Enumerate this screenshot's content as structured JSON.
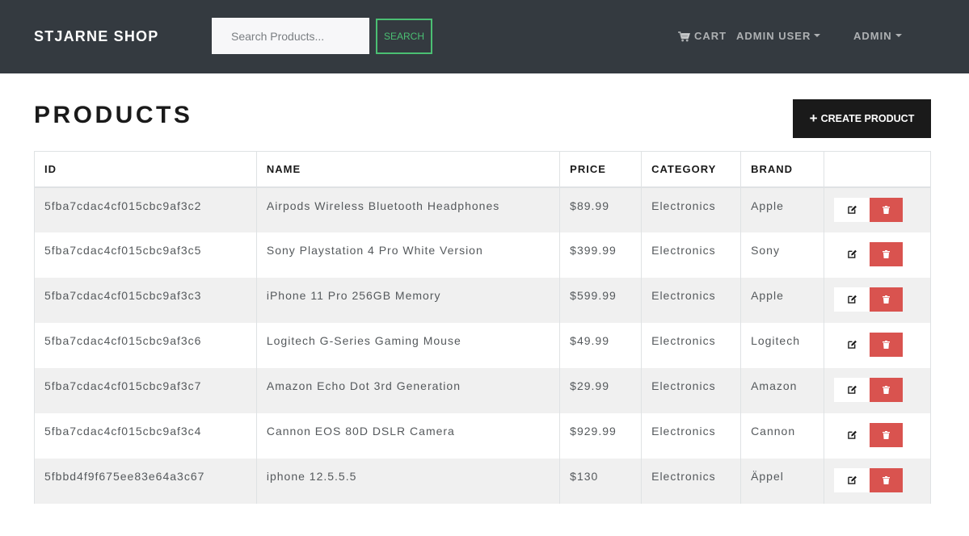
{
  "navbar": {
    "brand": "STJARNE SHOP",
    "search_placeholder": "Search Products...",
    "search_button": "SEARCH",
    "cart_label": "CART",
    "user_menu": "ADMIN USER",
    "admin_menu": "ADMIN"
  },
  "page": {
    "title": "PRODUCTS",
    "create_button": "CREATE PRODUCT"
  },
  "table": {
    "columns": [
      "ID",
      "NAME",
      "PRICE",
      "CATEGORY",
      "BRAND",
      ""
    ],
    "rows": [
      {
        "id": "5fba7cdac4cf015cbc9af3c2",
        "name": "Airpods Wireless Bluetooth Headphones",
        "price": "$89.99",
        "category": "Electronics",
        "brand": "Apple"
      },
      {
        "id": "5fba7cdac4cf015cbc9af3c5",
        "name": "Sony Playstation 4 Pro White Version",
        "price": "$399.99",
        "category": "Electronics",
        "brand": "Sony"
      },
      {
        "id": "5fba7cdac4cf015cbc9af3c3",
        "name": "iPhone 11 Pro 256GB Memory",
        "price": "$599.99",
        "category": "Electronics",
        "brand": "Apple"
      },
      {
        "id": "5fba7cdac4cf015cbc9af3c6",
        "name": "Logitech G-Series Gaming Mouse",
        "price": "$49.99",
        "category": "Electronics",
        "brand": "Logitech"
      },
      {
        "id": "5fba7cdac4cf015cbc9af3c7",
        "name": "Amazon Echo Dot 3rd Generation",
        "price": "$29.99",
        "category": "Electronics",
        "brand": "Amazon"
      },
      {
        "id": "5fba7cdac4cf015cbc9af3c4",
        "name": "Cannon EOS 80D DSLR Camera",
        "price": "$929.99",
        "category": "Electronics",
        "brand": "Cannon"
      },
      {
        "id": "5fbbd4f9f675ee83e64a3c67",
        "name": "iphone 12.5.5.5",
        "price": "$130",
        "category": "Electronics",
        "brand": "Äppel"
      }
    ],
    "row_actions": {
      "edit_icon": "edit-icon",
      "delete_icon": "trash-icon"
    }
  },
  "colors": {
    "navbar_bg": "#343a40",
    "success": "#4bbf73",
    "danger": "#d9534f",
    "primary_dark": "#1a1a1a",
    "stripe": "#f0f0f0"
  }
}
